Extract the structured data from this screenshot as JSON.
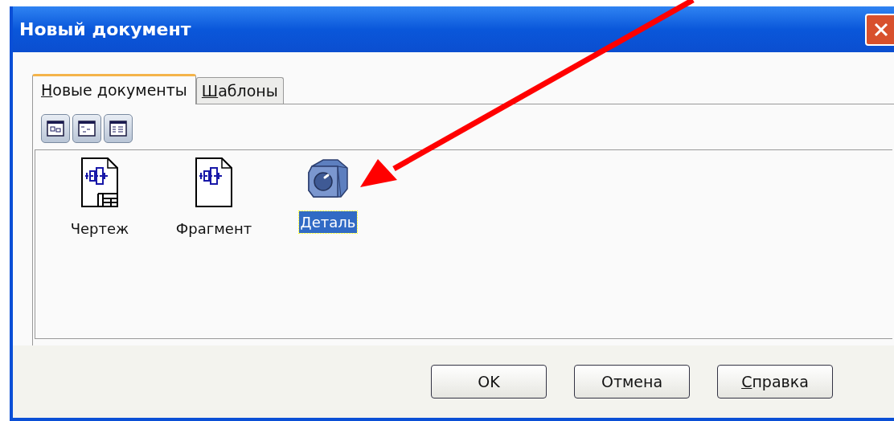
{
  "window": {
    "title": "Новый документ"
  },
  "tabs": [
    {
      "label": "Новые документы",
      "selected": true,
      "mnemonic": true
    },
    {
      "label": "Шаблоны",
      "selected": false,
      "mnemonic": true
    }
  ],
  "view_buttons": [
    {
      "kind": "large"
    },
    {
      "kind": "list"
    },
    {
      "kind": "details"
    }
  ],
  "items": [
    {
      "label": "Чертеж",
      "kind": "drawing",
      "selected": false
    },
    {
      "label": "Фрагмент",
      "kind": "fragment",
      "selected": false
    },
    {
      "label": "Деталь",
      "kind": "part",
      "selected": true
    }
  ],
  "buttons": [
    {
      "label": "OK",
      "mnemonic": false
    },
    {
      "label": "Отмена",
      "mnemonic": false
    },
    {
      "label": "Справка",
      "mnemonic": true
    }
  ]
}
